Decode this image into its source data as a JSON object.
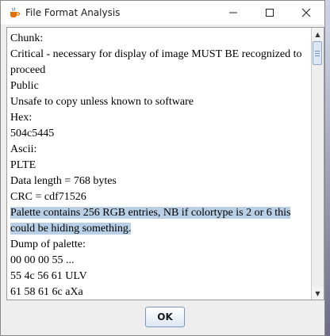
{
  "window": {
    "title": "File Format Analysis",
    "icon": "java-cup-icon",
    "controls": {
      "minimize": "minimize-icon",
      "maximize": "maximize-icon",
      "close": "close-icon"
    }
  },
  "content": {
    "lines": [
      "Chunk:",
      "Critical - necessary for display of image MUST BE recognized to",
      "proceed",
      "Public",
      "Unsafe to copy unless known to software",
      "Hex:",
      "504c5445",
      "Ascii:",
      "PLTE",
      "Data length = 768 bytes",
      "CRC = cdf71526",
      "Palette contains 256 RGB entries, NB if colortype is 2 or 6 this",
      "could be hiding something.",
      "Dump of palette:",
      "00 00 00 55 ...",
      "55 4c 56 61 ULV",
      "61 58 61 6c aXa"
    ]
  },
  "buttons": {
    "ok": "OK"
  },
  "colors": {
    "selection": "#b8cfe5",
    "accent": "#7a96bf"
  }
}
